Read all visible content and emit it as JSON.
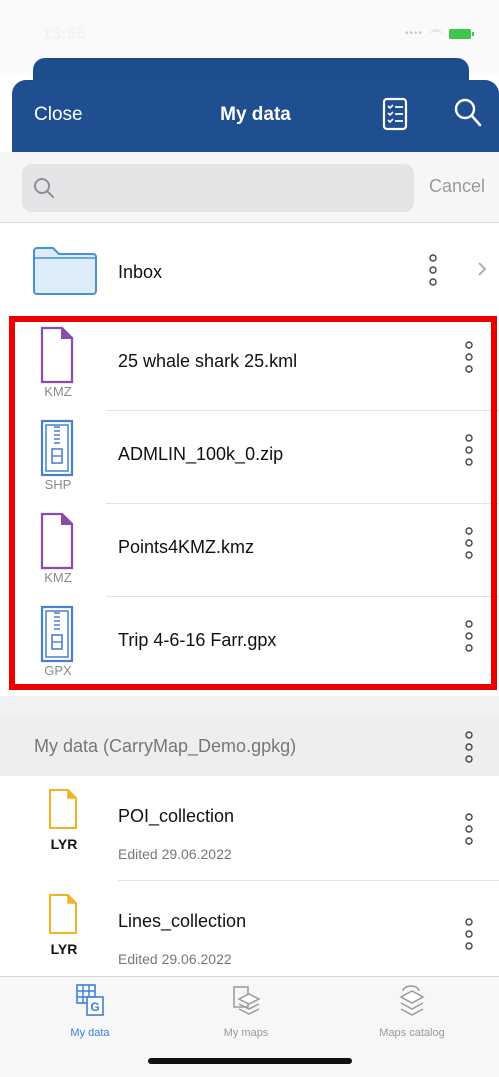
{
  "status_bar": {
    "time": "13:55",
    "signal_icon": "signal-dots-icon",
    "wifi_icon": "wifi-icon",
    "battery_icon": "battery-icon"
  },
  "nav": {
    "close_label": "Close",
    "title": "My data",
    "list_icon": "checklist-icon",
    "search_icon": "search-icon",
    "background": "#1f4f91"
  },
  "search": {
    "placeholder": "",
    "cancel_label": "Cancel"
  },
  "inbox": {
    "label": "Inbox"
  },
  "files": [
    {
      "name": "25 whale shark 25.kml",
      "type": "KMZ",
      "icon": "document-icon",
      "color": "#8a4ca8"
    },
    {
      "name": "ADMLIN_100k_0.zip",
      "type": "SHP",
      "icon": "zip-archive-icon",
      "color": "#4a7fd0"
    },
    {
      "name": "Points4KMZ.kmz",
      "type": "KMZ",
      "icon": "document-icon",
      "color": "#8a4ca8"
    },
    {
      "name": "Trip 4-6-16 Farr.gpx",
      "type": "GPX",
      "icon": "zip-archive-icon",
      "color": "#4a7fd0"
    }
  ],
  "highlight_color": "#ee0000",
  "section": {
    "title": "My data (CarryMap_Demo.gpkg)"
  },
  "layers": [
    {
      "name": "POI_collection",
      "edited": "Edited 29.06.2022",
      "type": "LYR",
      "color": "#f0b429"
    },
    {
      "name": "Lines_collection",
      "edited": "Edited 29.06.2022",
      "type": "LYR",
      "color": "#f0b429"
    }
  ],
  "tabs": [
    {
      "label": "My data",
      "icon": "data-table-icon",
      "active": true
    },
    {
      "label": "My maps",
      "icon": "layers-icon",
      "active": false
    },
    {
      "label": "Maps catalog",
      "icon": "layers-stack-icon",
      "active": false
    }
  ],
  "accent_color": "#3d7fd8"
}
